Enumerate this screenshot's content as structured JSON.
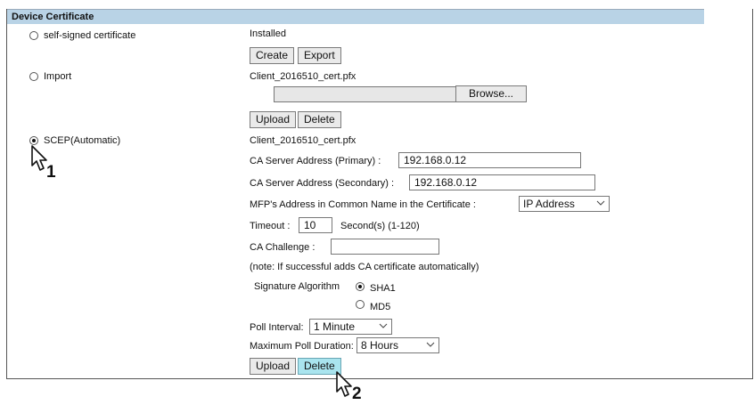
{
  "section_title": "Device Certificate",
  "options": {
    "self_signed": {
      "label": "self-signed certificate",
      "selected": false
    },
    "import": {
      "label": "Import",
      "selected": false
    },
    "scep": {
      "label": "SCEP(Automatic)",
      "selected": true
    }
  },
  "self_signed": {
    "status": "Installed",
    "create_label": "Create",
    "export_label": "Export"
  },
  "import": {
    "filename": "Client_2016510_cert.pfx",
    "browse_label": "Browse...",
    "upload_label": "Upload",
    "delete_label": "Delete"
  },
  "scep": {
    "filename": "Client_2016510_cert.pfx",
    "ca_primary_label": "CA Server Address (Primary)  :",
    "ca_primary_value": "192.168.0.12",
    "ca_secondary_label": "CA Server Address (Secondary)  :",
    "ca_secondary_value": "192.168.0.12",
    "mfp_label": "MFP's Address in Common Name in the Certificate  :",
    "mfp_value": "IP Address",
    "timeout_label": "Timeout  :",
    "timeout_value": "10",
    "timeout_unit": "Second(s) (1-120)",
    "challenge_label": "CA Challenge  :",
    "challenge_value": "",
    "note": "(note: If successful adds CA certificate automatically)",
    "sig_label": "Signature Algorithm",
    "sig_sha1": "SHA1",
    "sig_md5": "MD5",
    "sig_selected": "SHA1",
    "poll_interval_label": "Poll Interval:",
    "poll_interval_value": "1 Minute",
    "max_poll_label": "Maximum Poll Duration:",
    "max_poll_value": "8 Hours",
    "upload_label": "Upload",
    "delete_label": "Delete"
  },
  "callouts": {
    "step1": "1",
    "step2": "2"
  },
  "icons": {
    "cursor": "mouse-pointer-icon",
    "dropdown": "chevron-down-icon"
  }
}
